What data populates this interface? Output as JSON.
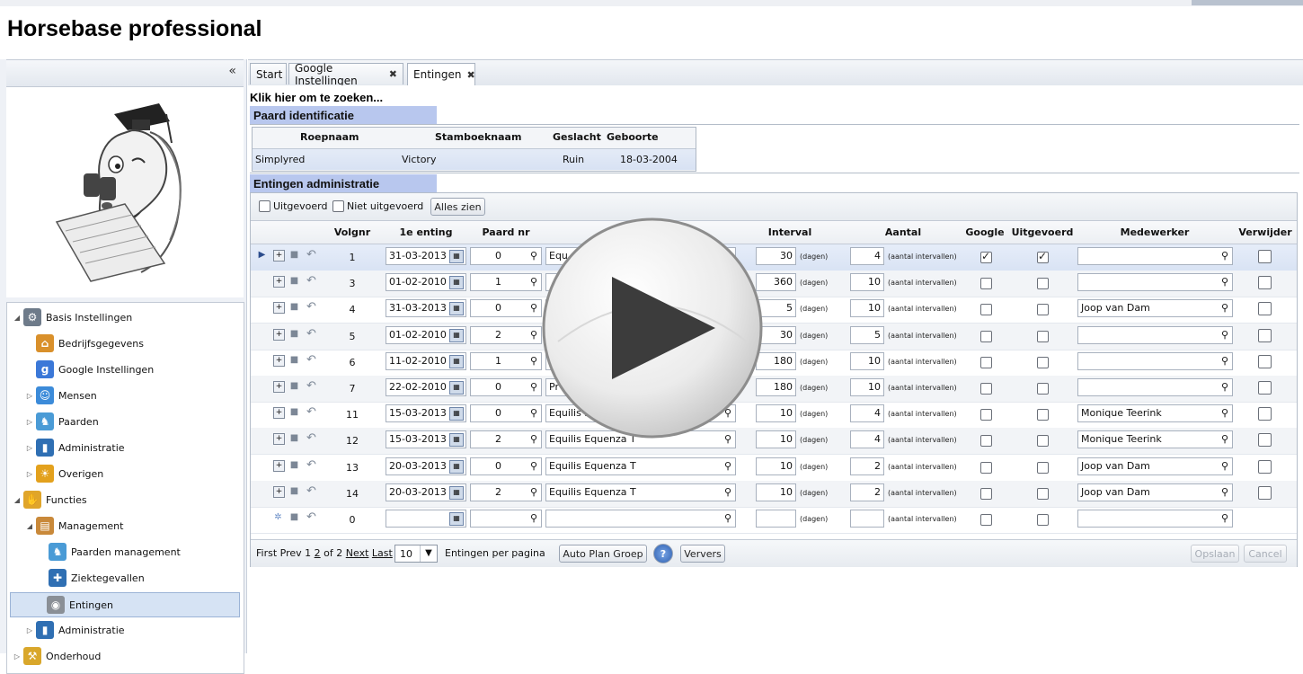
{
  "app": {
    "title": "Horsebase professional"
  },
  "sidebar": {
    "collapse_label": "«",
    "tree": [
      {
        "label": "Basis Instellingen",
        "icon": "gear-icon",
        "level": 0,
        "expanded": true,
        "color": "#6e7b8a"
      },
      {
        "label": "Bedrijfsgegevens",
        "icon": "house-icon",
        "level": 1,
        "color": "#d9902b"
      },
      {
        "label": "Google Instellingen",
        "icon": "google-icon",
        "level": 1,
        "color": "#3b78d8"
      },
      {
        "label": "Mensen",
        "icon": "people-icon",
        "level": 1,
        "expandable": true,
        "color": "#3c8bd9"
      },
      {
        "label": "Paarden",
        "icon": "horse-icon",
        "level": 1,
        "expandable": true,
        "color": "#4a9bd6"
      },
      {
        "label": "Administratie",
        "icon": "binder-icon",
        "level": 1,
        "expandable": true,
        "color": "#2f6fb3"
      },
      {
        "label": "Overigen",
        "icon": "sun-gear-icon",
        "level": 1,
        "expandable": true,
        "color": "#e3a11d"
      },
      {
        "label": "Functies",
        "icon": "hands-icon",
        "level": 0,
        "expanded": true,
        "color": "#e0a52a"
      },
      {
        "label": "Management",
        "icon": "board-icon",
        "level": 1,
        "expanded": true,
        "color": "#c9893a"
      },
      {
        "label": "Paarden management",
        "icon": "horse-icon",
        "level": 2,
        "color": "#4a9bd6"
      },
      {
        "label": "Ziektegevallen",
        "icon": "medicine-icon",
        "level": 2,
        "color": "#2f6fb3"
      },
      {
        "label": "Entingen",
        "icon": "vaccine-icon",
        "level": 2,
        "selected": true,
        "color": "#8a8f96"
      },
      {
        "label": "Administratie",
        "icon": "binder-icon",
        "level": 1,
        "expandable": true,
        "color": "#2f6fb3"
      },
      {
        "label": "Onderhoud",
        "icon": "tools-icon",
        "level": 0,
        "expandable": true,
        "color": "#d9a72b"
      }
    ]
  },
  "tabs": [
    {
      "label": "Start",
      "closable": false
    },
    {
      "label": "Google Instellingen",
      "closable": true
    },
    {
      "label": "Entingen",
      "closable": true,
      "active": true
    }
  ],
  "main": {
    "search_hint": "Klik hier om te zoeken...",
    "paard_section": "Paard identificatie",
    "paard_grid": {
      "headers": [
        "Roepnaam",
        "Stamboeknaam",
        "Geslacht",
        "Geboorte Datum"
      ],
      "row": [
        "Simplyred",
        "Victory",
        "Ruin",
        "18-03-2004"
      ]
    },
    "entingen_section": "Entingen administratie",
    "toolbar": {
      "uitgevoerd": "Uitgevoerd",
      "niet_uitgevoerd": "Niet uitgevoerd",
      "alles_zien": "Alles zien"
    },
    "columns": {
      "volgnr": "Volgnr",
      "enting": "1e enting",
      "paard": "Paard nr",
      "interval": "Interval",
      "aantal": "Aantal",
      "google": "Google",
      "uitgevoerd": "Uitgevoerd",
      "medewerker": "Medewerker",
      "verwijder": "Verwijder"
    },
    "units": {
      "dagen": "(dagen)",
      "intervallen": "(aantal intervallen)"
    },
    "rows": [
      {
        "volgnr": "1",
        "date": "31-03-2013",
        "paard": "0",
        "vaccin": "Equ",
        "interval": "30",
        "aantal": "4",
        "google": true,
        "uitgevoerd": true,
        "medewerker": ""
      },
      {
        "volgnr": "3",
        "date": "01-02-2010",
        "paard": "1",
        "vaccin": "",
        "interval": "360",
        "aantal": "10",
        "google": false,
        "uitgevoerd": false,
        "medewerker": ""
      },
      {
        "volgnr": "4",
        "date": "31-03-2013",
        "paard": "0",
        "vaccin": "",
        "interval": "5",
        "aantal": "10",
        "google": false,
        "uitgevoerd": false,
        "medewerker": "Joop van Dam"
      },
      {
        "volgnr": "5",
        "date": "01-02-2010",
        "paard": "2",
        "vaccin": "",
        "interval": "30",
        "aantal": "5",
        "google": false,
        "uitgevoerd": false,
        "medewerker": ""
      },
      {
        "volgnr": "6",
        "date": "11-02-2010",
        "paard": "1",
        "vaccin": "",
        "interval": "180",
        "aantal": "10",
        "google": false,
        "uitgevoerd": false,
        "medewerker": ""
      },
      {
        "volgnr": "7",
        "date": "22-02-2010",
        "paard": "0",
        "vaccin": "Pr",
        "interval": "180",
        "aantal": "10",
        "google": false,
        "uitgevoerd": false,
        "medewerker": ""
      },
      {
        "volgnr": "11",
        "date": "15-03-2013",
        "paard": "0",
        "vaccin": "Equilis E",
        "interval": "10",
        "aantal": "4",
        "google": false,
        "uitgevoerd": false,
        "medewerker": "Monique Teerink"
      },
      {
        "volgnr": "12",
        "date": "15-03-2013",
        "paard": "2",
        "vaccin": "Equilis Equenza T",
        "interval": "10",
        "aantal": "4",
        "google": false,
        "uitgevoerd": false,
        "medewerker": "Monique Teerink"
      },
      {
        "volgnr": "13",
        "date": "20-03-2013",
        "paard": "0",
        "vaccin": "Equilis Equenza T",
        "interval": "10",
        "aantal": "2",
        "google": false,
        "uitgevoerd": false,
        "medewerker": "Joop van Dam"
      },
      {
        "volgnr": "14",
        "date": "20-03-2013",
        "paard": "2",
        "vaccin": "Equilis Equenza T",
        "interval": "10",
        "aantal": "2",
        "google": false,
        "uitgevoerd": false,
        "medewerker": "Joop van Dam"
      },
      {
        "volgnr": "0",
        "date": "",
        "paard": "",
        "vaccin": "",
        "interval": "",
        "aantal": "",
        "google": false,
        "uitgevoerd": false,
        "medewerker": "",
        "new": true
      }
    ],
    "pager": {
      "first": "First",
      "prev": "Prev",
      "p1": "1",
      "p2": "2",
      "of": "of 2",
      "next": "Next",
      "last": "Last",
      "page_size": "10",
      "per_page": "Entingen per pagina",
      "auto_plan": "Auto Plan Groep",
      "help": "?",
      "ververs": "Ververs",
      "opslaan": "Opslaan",
      "cancel": "Cancel"
    }
  },
  "colors": {
    "accent": "#b8c7ee",
    "selected": "#d6e3f4",
    "link": "#0000cc"
  }
}
